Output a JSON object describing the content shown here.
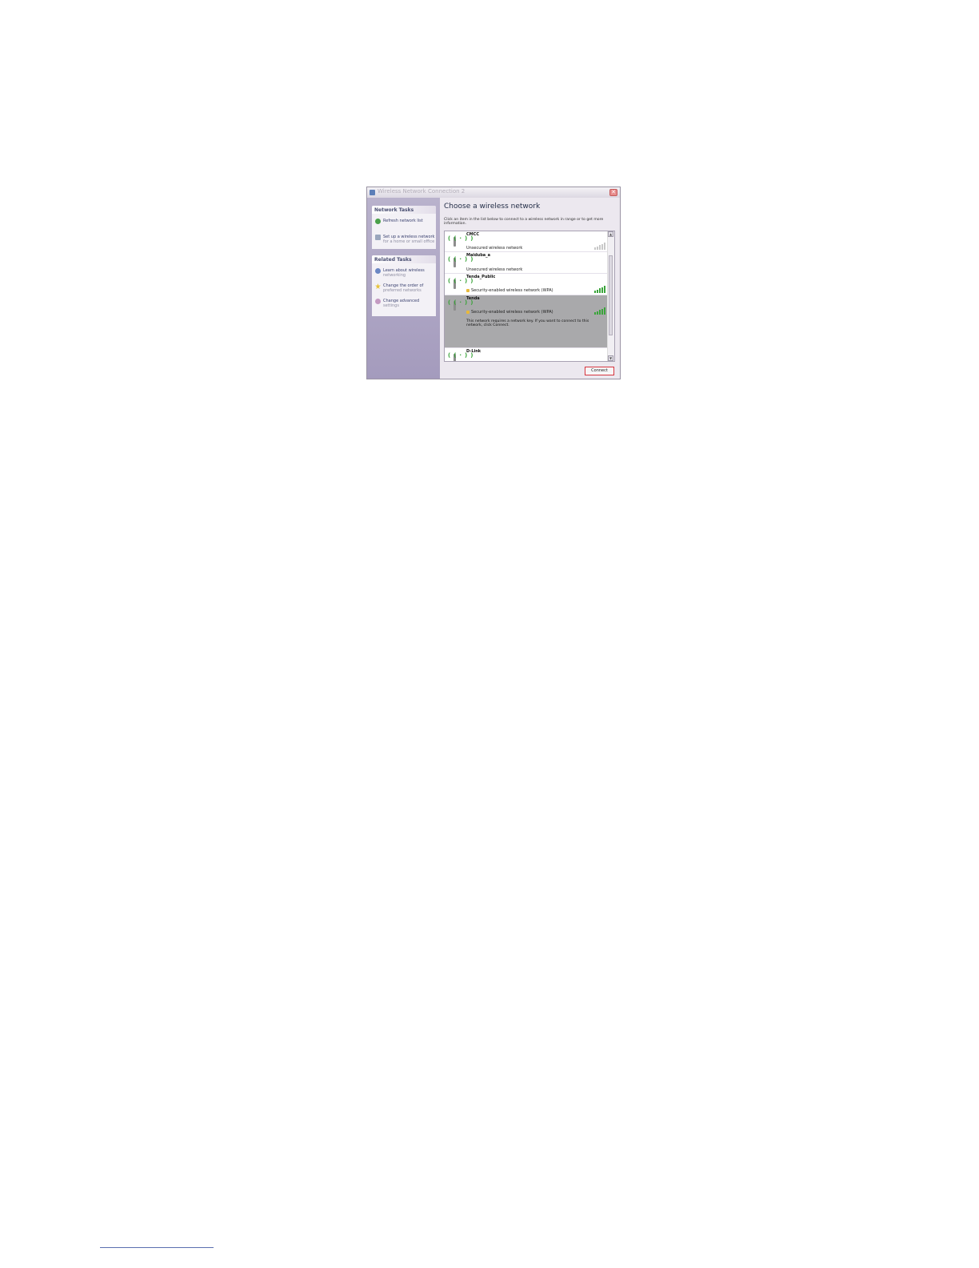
{
  "window": {
    "title": "Wireless Network Connection 2",
    "close_glyph": "✕"
  },
  "sidebar": {
    "network_tasks": {
      "header": "Network Tasks",
      "items": [
        {
          "label": "Refresh network list",
          "sub": "",
          "icon": "refresh-icon"
        },
        {
          "label": "Set up a wireless network",
          "sub": "for a home or small office",
          "icon": "setup-network-icon"
        }
      ]
    },
    "related_tasks": {
      "header": "Related Tasks",
      "items": [
        {
          "label": "Learn about wireless",
          "sub": "networking",
          "icon": "info-icon"
        },
        {
          "label": "Change the order of",
          "sub": "preferred networks",
          "icon": "star-icon"
        },
        {
          "label": "Change advanced",
          "sub": "settings",
          "icon": "settings-icon"
        }
      ]
    }
  },
  "main": {
    "title": "Choose a wireless network",
    "description": "Click an item in the list below to connect to a wireless network in range or to get more information.",
    "networks": [
      {
        "name": "CMCC",
        "status": "Unsecured wireless network",
        "secured": false,
        "selected": false,
        "signal_bars": 0
      },
      {
        "name": "Maiduba_a",
        "status": "Unsecured wireless network",
        "secured": false,
        "selected": false,
        "signal_bars": 0
      },
      {
        "name": "Tenda_Public",
        "status": "Security-enabled wireless network (WPA)",
        "secured": true,
        "selected": false,
        "signal_bars": 5
      },
      {
        "name": "Tenda",
        "status": "Security-enabled wireless network (WPA)",
        "secured": true,
        "selected": true,
        "signal_bars": 5,
        "detail": "This network requires a network key. If you want to connect to this network, click Connect."
      },
      {
        "name": "D-Link",
        "status": "",
        "secured": false,
        "selected": false,
        "signal_bars": 0
      }
    ],
    "connect_label": "Connect",
    "scroll_up": "▲",
    "scroll_down": "▼"
  },
  "colors": {
    "accent": "#d2323c",
    "signal_green": "#3aa43a",
    "sidebar": "#b0a8c6"
  }
}
